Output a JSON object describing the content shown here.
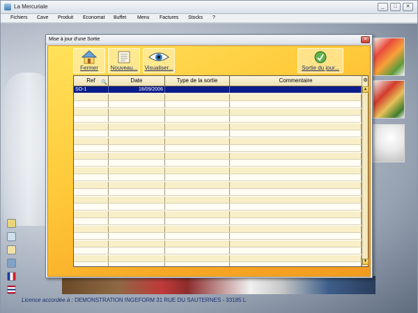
{
  "app": {
    "title": "La Mercuriale",
    "window_controls": {
      "minimize": "_",
      "maximize": "□",
      "close": "✕"
    }
  },
  "menu": [
    {
      "label": "Fichiers"
    },
    {
      "label": "Cave"
    },
    {
      "label": "Produit"
    },
    {
      "label": "Economat"
    },
    {
      "label": "Buffet"
    },
    {
      "label": "Menu"
    },
    {
      "label": "Factures"
    },
    {
      "label": "Stocks"
    },
    {
      "label": "?"
    }
  ],
  "dialog": {
    "title": "Mise à jour d'une Sortie",
    "close_glyph": "✕",
    "toolbar": {
      "fermer": "Fermer",
      "nouveau": "Nouveau...",
      "visualiser": "Visualiser...",
      "sortie_du_jour": "Sortie du jour..."
    },
    "table": {
      "columns": [
        "Ref",
        "Date",
        "Type de la sortie",
        "Commentaire"
      ],
      "rows": [
        {
          "ref": "SO-1",
          "date": "18/09/2006",
          "type": "",
          "commentaire": ""
        }
      ],
      "empty_rows": 24,
      "selected_row": 0
    },
    "scroll": {
      "up": "▲",
      "down": "▼"
    }
  },
  "licence": {
    "label": "Licence accordée à :",
    "text": "DEMONSTRATION INGEFORM  31 RUE DU SAUTERNES  - 33185 L"
  },
  "colors": {
    "dialog_body": "#ffc93a",
    "selection": "#0a1c8a",
    "link_text": "#1b2a66"
  },
  "icons": [
    "house-icon",
    "document-icon",
    "eye-icon",
    "green-ball-icon"
  ]
}
